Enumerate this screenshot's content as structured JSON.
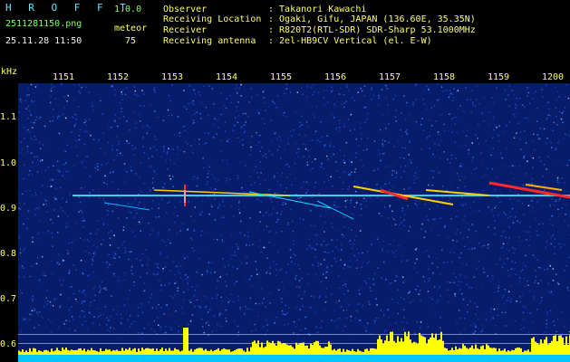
{
  "app": {
    "brand": "H R O F F T",
    "version": "1.0.0",
    "filename": "2511281150.png",
    "datetime": "25.11.28 11:50",
    "mode_label": "meteor",
    "count": "75"
  },
  "info": {
    "labels": [
      "Observer",
      "Receiving Location",
      "Receiver",
      "Receiving antenna"
    ],
    "values": [
      ": Takanori Kawachi",
      ": Ogaki, Gifu, JAPAN (136.60E, 35.35N)",
      ": R820T2(RTL-SDR) SDR-Sharp 53.1000MHz",
      ": 2el-HB9CV Vertical (el. E-W)"
    ]
  },
  "axis": {
    "unit": "kHz",
    "time_ticks": [
      "1151",
      "1152",
      "1153",
      "1154",
      "1155",
      "1156",
      "1157",
      "1158",
      "1159",
      "1200"
    ],
    "freq_ticks": [
      "1.1",
      "1.0",
      "0.9",
      "0.8",
      "0.7",
      "0.6"
    ]
  },
  "colors": {
    "background": "#000000",
    "spectrogram_bg": "#071c6b",
    "noise": "#2f6fff",
    "signal": "#ff3030",
    "level_bars": "#ffff00",
    "level_base": "#00c8ff"
  }
}
